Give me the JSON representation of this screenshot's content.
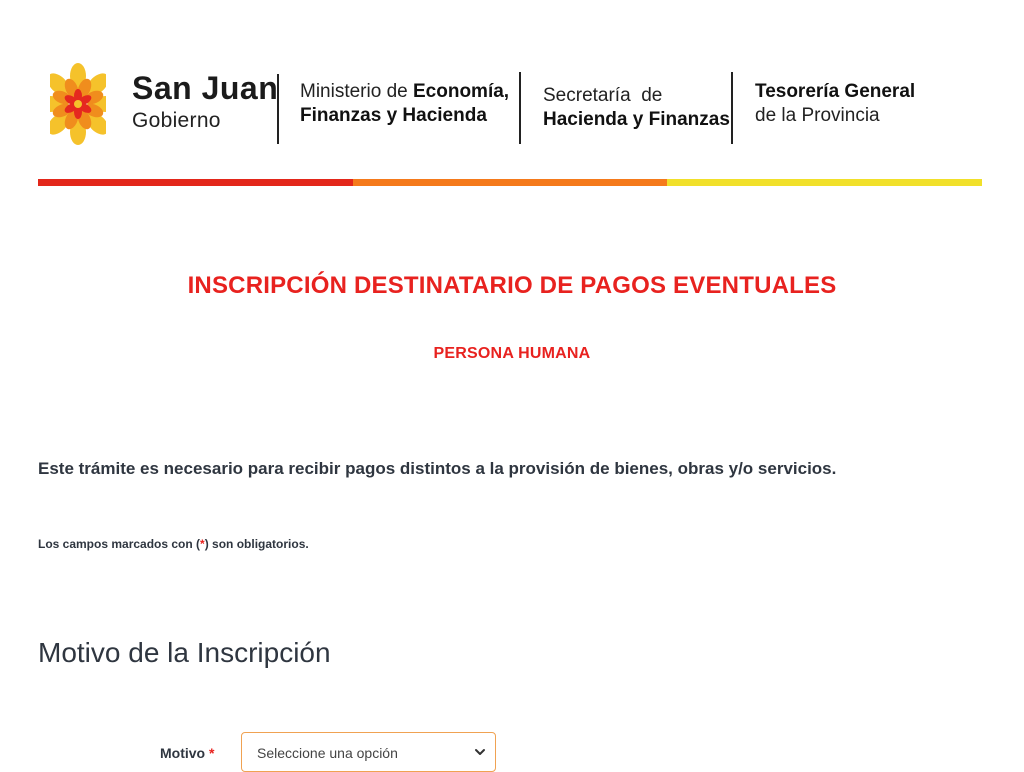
{
  "header": {
    "brand": {
      "title": "San Juan",
      "subtitle": "Gobierno"
    },
    "ministry": {
      "line1_prefix": "Ministerio de ",
      "line1_bold": "Economía,",
      "line2": "Finanzas y Hacienda"
    },
    "secretariat": {
      "line1": "Secretaría  de",
      "line2": "Hacienda y Finanzas"
    },
    "treasury": {
      "line1": "Tesorería General",
      "line2": "de la Provincia"
    },
    "color_bar": [
      "#e3271a",
      "#f57a1b",
      "#f1e02a"
    ],
    "logo_colors": {
      "outer": "#f5c22b",
      "mid": "#f08d1d",
      "inner": "#e5281f"
    }
  },
  "page": {
    "title": "INSCRIPCIÓN DESTINATARIO DE PAGOS EVENTUALES",
    "subtitle": "PERSONA HUMANA",
    "intro": "Este trámite es necesario para recibir pagos distintos a la provisión de bienes, obras y/o servicios.",
    "required_note": {
      "prefix": "Los campos marcados con (",
      "star": "*",
      "suffix": ") son obligatorios."
    },
    "accent_color": "#e8221f"
  },
  "form": {
    "section_title": "Motivo de la Inscripción",
    "motivo": {
      "label": "Motivo",
      "required_mark": "*",
      "selected": "Seleccione una opción",
      "icon": "chevron-down-icon"
    }
  }
}
